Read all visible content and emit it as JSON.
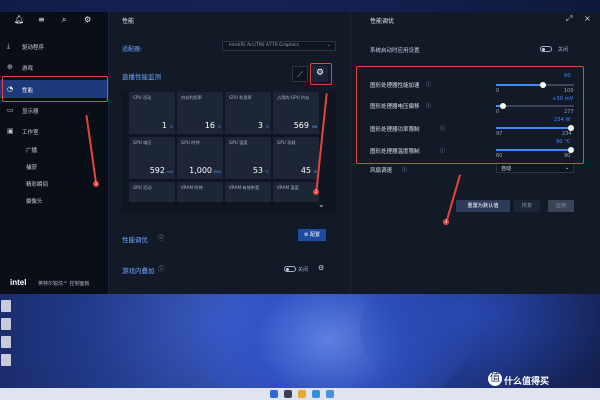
{
  "sidebar": {
    "items": [
      {
        "label": "驱动程序",
        "icon": "download-icon"
      },
      {
        "label": "游戏",
        "icon": "gamepad-icon"
      },
      {
        "label": "性能",
        "icon": "gauge-icon"
      },
      {
        "label": "显示器",
        "icon": "monitor-icon"
      },
      {
        "label": "工作室",
        "icon": "studio-icon"
      }
    ],
    "studio_subitems": [
      "广播",
      "捕获",
      "精彩瞬间",
      "摄像头"
    ],
    "brand": "intel",
    "brand_text": "英特尔锐炫™ 控制面板"
  },
  "center": {
    "title": "性能",
    "adapter_label": "适配器:",
    "adapter_value": "Intel(R) Arc(TM) A770 Graphics",
    "live_monitor_title": "直播性能监测",
    "metrics_row1": [
      {
        "label": "CPU 活动",
        "value": "1",
        "unit": "%"
      },
      {
        "label": "内存利用率",
        "value": "16",
        "unit": "%"
      },
      {
        "label": "GPU 利用率",
        "value": "3",
        "unit": "%"
      },
      {
        "label": "占用的 GPU 内存",
        "value": "569",
        "unit": "MB"
      }
    ],
    "metrics_row2": [
      {
        "label": "GPU 电压",
        "value": "592",
        "unit": "mV"
      },
      {
        "label": "GPU 时钟",
        "value": "1,000",
        "unit": "MHz"
      },
      {
        "label": "GPU 温度",
        "value": "53",
        "unit": "°C"
      },
      {
        "label": "GPU 功耗",
        "value": "45",
        "unit": "W"
      }
    ],
    "metrics_row3": [
      {
        "label": "GPU 活动"
      },
      {
        "label": "VRAM 时钟"
      },
      {
        "label": "VRAM 有效带宽"
      },
      {
        "label": "VRAM 温度"
      }
    ],
    "tuning_label": "性能调优",
    "config_button": "配置",
    "overlay_label": "游戏内叠加",
    "overlay_toggle": "关闭"
  },
  "right": {
    "title": "性能调优",
    "startup_label": "系统启动时应用设置",
    "startup_toggle": "关闭",
    "sliders": [
      {
        "label": "图形处理器性能加速",
        "value": "60",
        "min": "0",
        "max": "100",
        "level": 0.6
      },
      {
        "label": "图形处理器电压偏移",
        "value": "+30 mV",
        "min": "0",
        "max": "277",
        "level": 0.11
      },
      {
        "label": "图形处理器功率限制",
        "value": "234 W",
        "min": "97",
        "max": "234",
        "level": 1.0
      },
      {
        "label": "图形处理器温度限制",
        "value": "90 °C",
        "min": "60",
        "max": "90",
        "level": 1.0
      }
    ],
    "fan_label": "风扇调速",
    "fan_value": "自动",
    "reset_button": "重置为默认值",
    "restore_button": "恢复",
    "apply_button": "应用"
  },
  "annotations": [
    "1",
    "2",
    "3"
  ],
  "watermark": "什么值得买",
  "watermark_glyph": "值"
}
